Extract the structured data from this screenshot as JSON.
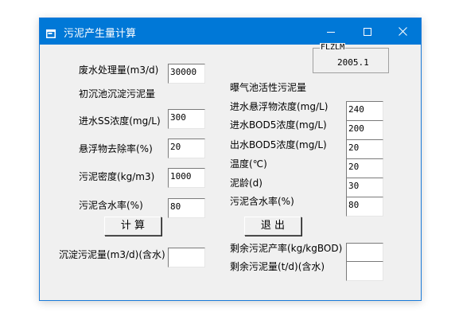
{
  "window": {
    "title": "污泥产生量计算",
    "app_icon": "form-icon",
    "controls": {
      "minimize_icon": "minimize-icon",
      "maximize_icon": "maximize-icon",
      "close_icon": "close-icon"
    }
  },
  "left": {
    "flow_label": "废水处理量(m3/d)",
    "flow_value": "30000",
    "primary_header": "初沉池沉淀污泥量",
    "ss_label": "进水SS浓度(mg/L)",
    "ss_value": "300",
    "removal_label": "悬浮物去除率(%)",
    "removal_value": "20",
    "density_label": "污泥密度(kg/m3)",
    "density_value": "1000",
    "moisture_label": "污泥含水率(%)",
    "moisture_value": "80",
    "calc_button": "计  算",
    "result_label": "沉淀污泥量(m3/d)(含水)",
    "result_value": ""
  },
  "frame": {
    "legend": "FLZLM",
    "text": "2005.1"
  },
  "right": {
    "header": "曝气池活性污泥量",
    "ss_label": "进水悬浮物浓度(mg/L)",
    "ss_value": "240",
    "bod_in_label": "进水BOD5浓度(mg/L)",
    "bod_in_value": "200",
    "bod_out_label": "出水BOD5浓度(mg/L)",
    "bod_out_value": "20",
    "temp_label": "温度(℃)",
    "temp_value": "20",
    "age_label": "泥龄(d)",
    "age_value": "30",
    "moisture_label": "污泥含水率(%)",
    "moisture_value": "80",
    "exit_button": "退  出",
    "yield_label": "剩余污泥产率(kg/kgBOD)",
    "yield_value": "",
    "excess_label": "剩余污泥量(t/d)(含水)",
    "excess_value": ""
  }
}
